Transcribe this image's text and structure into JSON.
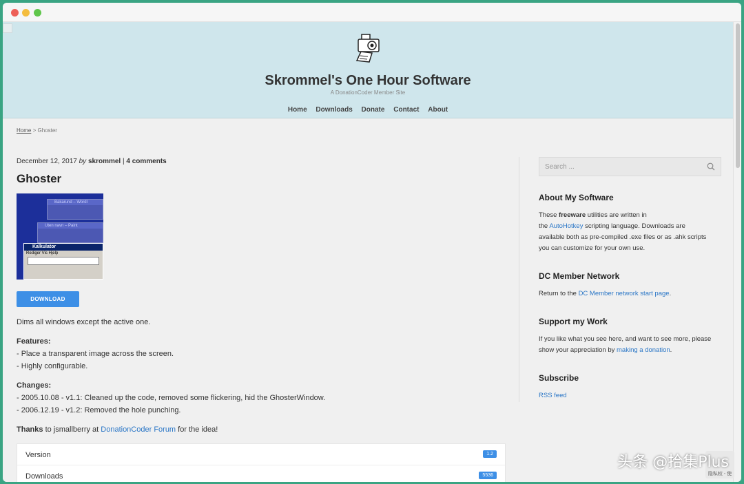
{
  "site": {
    "title": "Skrommel's One Hour Software",
    "tagline": "A DonationCoder Member Site",
    "nav": [
      "Home",
      "Downloads",
      "Donate",
      "Contact",
      "About"
    ]
  },
  "breadcrumb": {
    "home": "Home",
    "sep": ">",
    "current": "Ghoster"
  },
  "post": {
    "date": "December 12, 2017",
    "by": "by",
    "author": "skrommel",
    "sep": "|",
    "comments": "4 comments",
    "title": "Ghoster",
    "download_label": "DOWNLOAD",
    "description": "Dims all windows except the active one.",
    "features_heading": "Features:",
    "features": [
      "- Place a transparent image across the screen.",
      "- Highly configurable."
    ],
    "changes_heading": "Changes:",
    "changes": [
      "- 2005.10.08 - v1.1: Cleaned up the code, removed some flickering, hid the GhosterWindow.",
      "- 2006.12.19 - v1.2: Removed the hole punching."
    ],
    "thanks_bold": "Thanks",
    "thanks_pre": " to jsmallberry at ",
    "thanks_link": "DonationCoder Forum",
    "thanks_post": " for the idea!",
    "details": [
      {
        "label": "Version",
        "value": "1.2"
      },
      {
        "label": "Downloads",
        "value": "5536"
      }
    ]
  },
  "screenshot": {
    "win1": "Bakarund – Wordl",
    "win2": "Uten navn – Paint",
    "kalk_title": "Kalkulator",
    "kalk_menu": "Rediger  Vis  Hjelp"
  },
  "sidebar": {
    "search_placeholder": "Search ...",
    "about_title": "About My Software",
    "about_l1_pre": "These ",
    "about_l1_bold": "freeware",
    "about_l1_post": " utilities are written in",
    "about_l2_pre": "the ",
    "about_l2_link": "AutoHotkey",
    "about_l2_post": " scripting language. Downloads are",
    "about_l3": "available both as pre-compiled .exe files or as .ahk scripts",
    "about_l4": "you can customize for your own use.",
    "dc_title": "DC Member Network",
    "dc_pre": "Return to the ",
    "dc_link": "DC Member network start page",
    "dc_post": ".",
    "support_title": "Support my Work",
    "support_l1": "If you like what you see here, and want to see more, please",
    "support_l2_pre": "show your appreciation by ",
    "support_l2_link": "making a donation",
    "support_l2_post": ".",
    "subscribe_title": "Subscribe",
    "rss": "RSS feed"
  },
  "overlay": {
    "watermark": "头条 @拾集Plus",
    "corner": "隐私权 - 使"
  },
  "colors": {
    "header_bg": "#cfe6ec",
    "accent": "#3d8fe6",
    "link": "#2a76c6"
  }
}
